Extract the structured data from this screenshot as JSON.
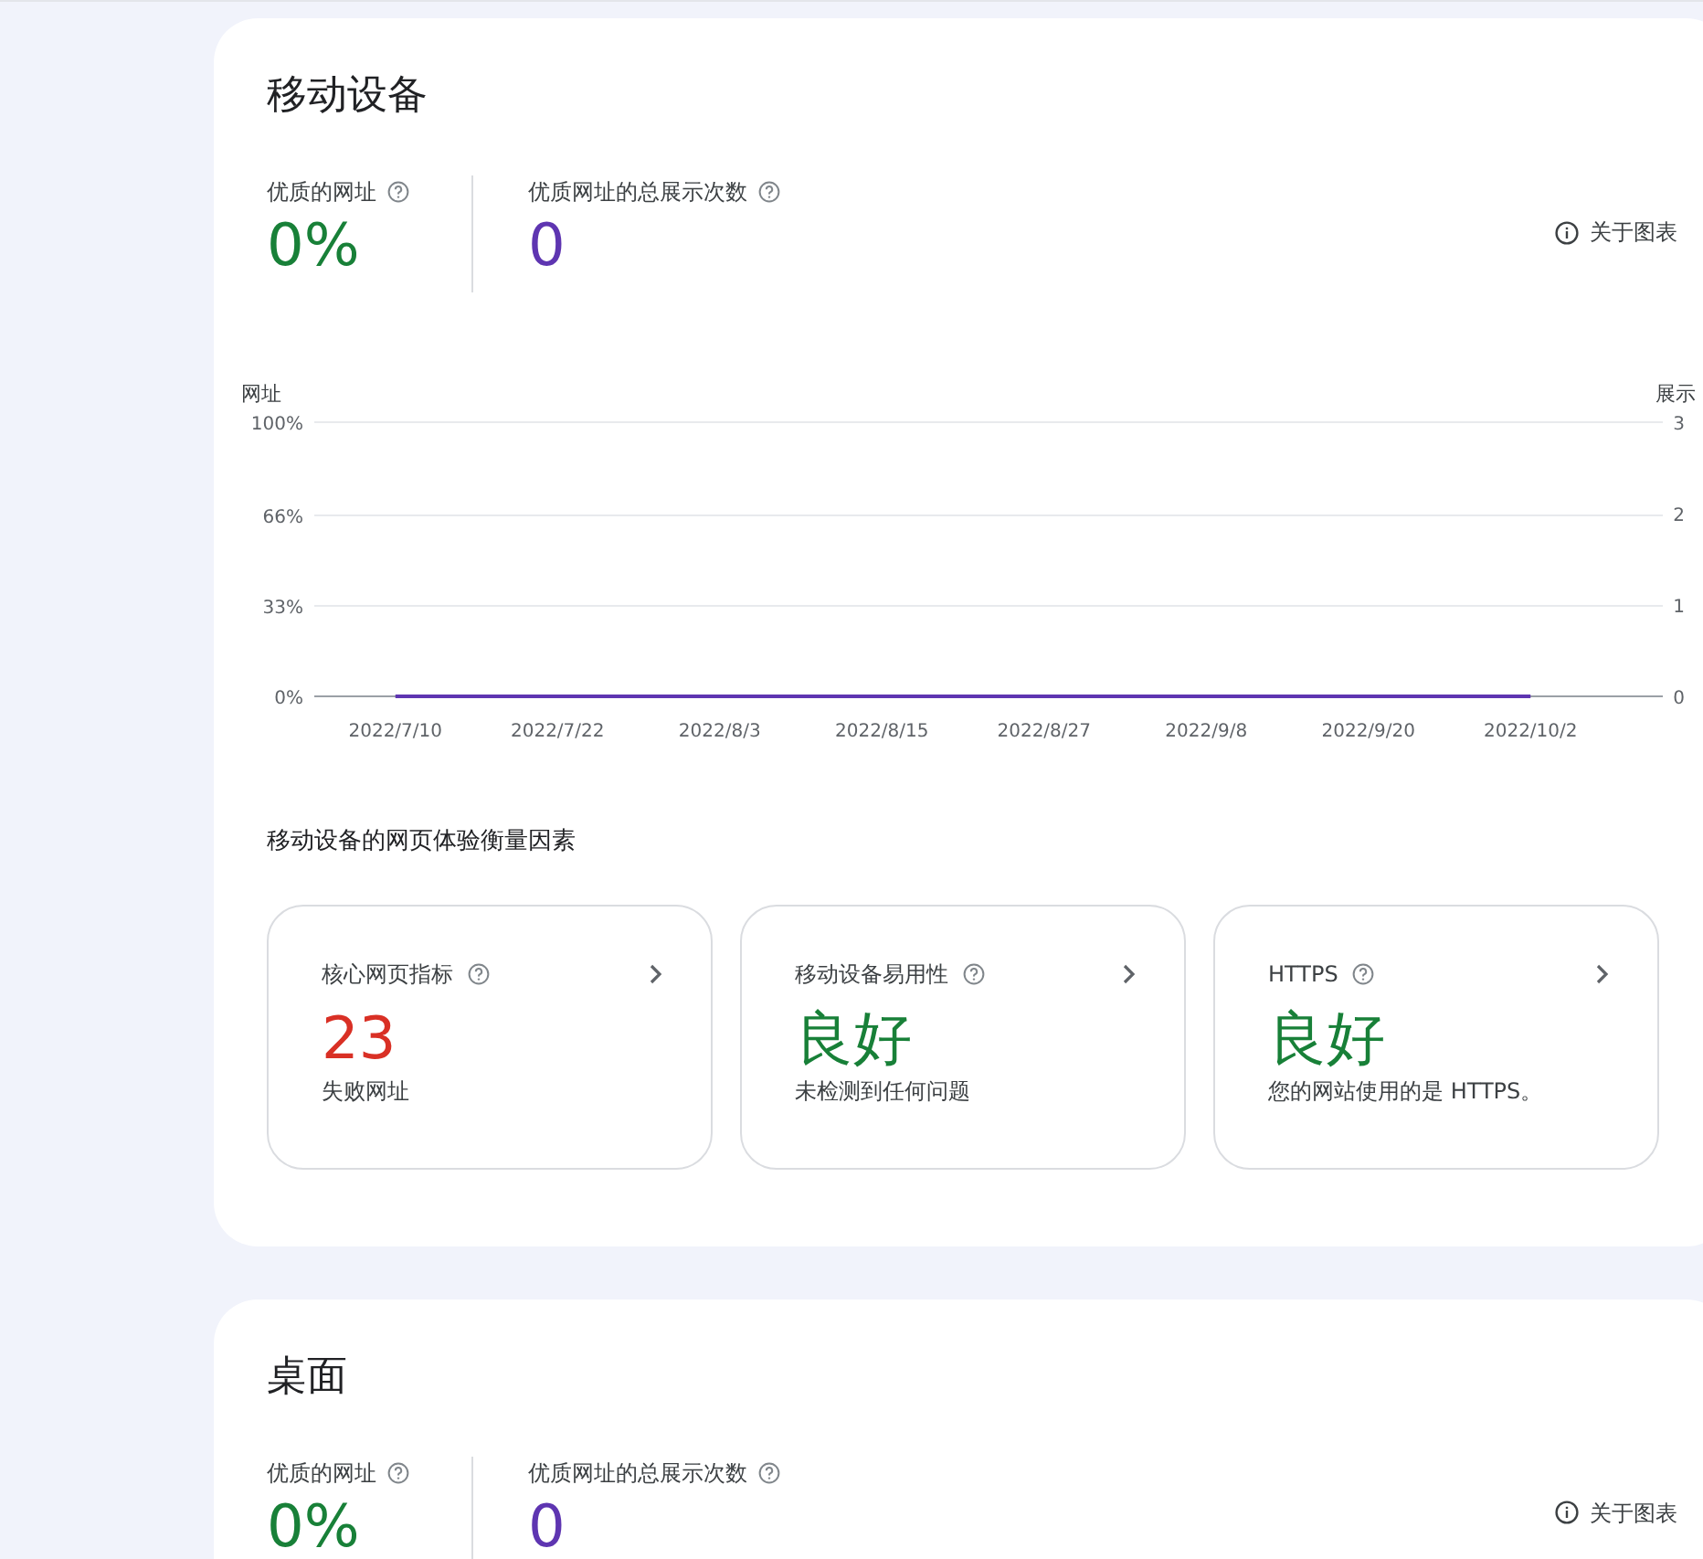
{
  "sections": [
    {
      "title": "移动设备",
      "metrics": [
        {
          "kind": "percent",
          "label": "优质的网址",
          "value": "0%"
        },
        {
          "kind": "count",
          "label": "优质网址的总展示次数",
          "value": "0"
        }
      ],
      "about_link": "关于图表",
      "chart_data": {
        "type": "line",
        "ylabel": "网址",
        "y2label": "展示",
        "categories": [
          "2022/7/10",
          "2022/7/22",
          "2022/8/3",
          "2022/8/15",
          "2022/8/27",
          "2022/9/8",
          "2022/9/20",
          "2022/10/2"
        ],
        "series": [
          {
            "color": "#5e35b1",
            "values": [
              0,
              0,
              0,
              0,
              0,
              0,
              0,
              0
            ]
          }
        ],
        "ylim": [
          0,
          100
        ],
        "yticks": [
          {
            "value": 0,
            "label": "0%"
          },
          {
            "value": 33,
            "label": "33%"
          },
          {
            "value": 66,
            "label": "66%"
          },
          {
            "value": 100,
            "label": "100%"
          }
        ],
        "y2ticks": [
          "0",
          "1",
          "2",
          "3"
        ]
      },
      "factors_title": "移动设备的网页体验衡量因素",
      "factors": [
        {
          "kind": "fail",
          "title": "核心网页指标",
          "value": "23",
          "caption": "失败网址"
        },
        {
          "kind": "good",
          "title": "移动设备易用性",
          "value": "良好",
          "caption": "未检测到任何问题"
        },
        {
          "kind": "good",
          "title": "HTTPS",
          "value": "良好",
          "caption": "您的网站使用的是 HTTPS。"
        }
      ]
    },
    {
      "title": "桌面",
      "metrics": [
        {
          "kind": "percent",
          "label": "优质的网址",
          "value": "0%"
        },
        {
          "kind": "count",
          "label": "优质网址的总展示次数",
          "value": "0"
        }
      ],
      "about_link": "关于图表"
    }
  ]
}
